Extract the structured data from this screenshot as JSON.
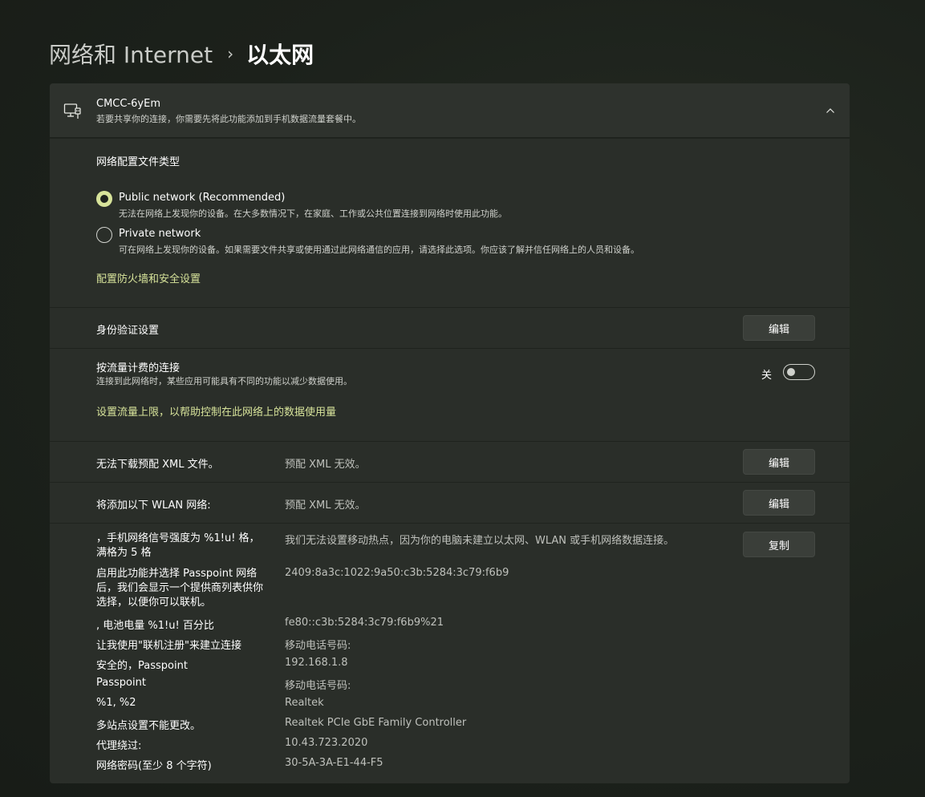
{
  "breadcrumb": {
    "parent": "网络和 Internet",
    "separator": "›",
    "current": "以太网"
  },
  "network": {
    "name": "CMCC-6yEm",
    "description": "若要共享你的连接，你需要先将此功能添加到手机数据流量套餐中。",
    "icon": "ethernet-pc-icon",
    "collapse_icon": "chevron-up-icon"
  },
  "profile": {
    "title": "网络配置文件类型",
    "options": [
      {
        "label": "Public network (Recommended)",
        "description": "无法在网络上发现你的设备。在大多数情况下，在家庭、工作或公共位置连接到网络时使用此功能。",
        "selected": true
      },
      {
        "label": "Private network",
        "description": "可在网络上发现你的设备。如果需要文件共享或使用通过此网络通信的应用，请选择此选项。你应该了解并信任网络上的人员和设备。",
        "selected": false
      }
    ],
    "firewall_link": "配置防火墙和安全设置"
  },
  "auth": {
    "label": "身份验证设置",
    "button": "编辑"
  },
  "metered": {
    "label": "按流量计费的连接",
    "description": "连接到此网络时，某些应用可能具有不同的功能以减少数据使用。",
    "state_label": "关",
    "on": false,
    "limit_link": "设置流量上限，以帮助控制在此网络上的数据使用量"
  },
  "xml": {
    "label": "无法下载预配 XML 文件。",
    "value": "预配 XML 无效。",
    "button": "编辑"
  },
  "wlan": {
    "label": "将添加以下 WLAN 网络:",
    "value": "预配 XML 无效。",
    "button": "编辑"
  },
  "properties": {
    "copy_button": "复制",
    "rows": [
      {
        "label": "，手机网络信号强度为 %1!u! 格，满格为 5 格",
        "value": "我们无法设置移动热点，因为你的电脑未建立以太网、WLAN 或手机网络数据连接。"
      },
      {
        "label": "启用此功能并选择 Passpoint 网络后，我们会显示一个提供商列表供你选择，以便你可以联机。",
        "value": "2409:8a3c:1022:9a50:c3b:5284:3c79:f6b9"
      },
      {
        "label": ", 电池电量 %1!u! 百分比",
        "value": "fe80::c3b:5284:3c79:f6b9%21"
      },
      {
        "label": "让我使用\"联机注册\"来建立连接",
        "value": "移动电话号码:"
      },
      {
        "label": "安全的，Passpoint",
        "value": "192.168.1.8"
      },
      {
        "label": "Passpoint",
        "value": "移动电话号码:"
      },
      {
        "label": "%1, %2",
        "value": "Realtek"
      },
      {
        "label": "多站点设置不能更改。",
        "value": "Realtek PCIe GbE Family Controller"
      },
      {
        "label": "代理绕过:",
        "value": "10.43.723.2020"
      },
      {
        "label": "网络密码(至少 8 个字符)",
        "value": "30-5A-3A-E1-44-F5"
      }
    ]
  },
  "colors": {
    "accent": "#d7e39a",
    "card": "#2a2e29",
    "background": "#1b2019"
  }
}
